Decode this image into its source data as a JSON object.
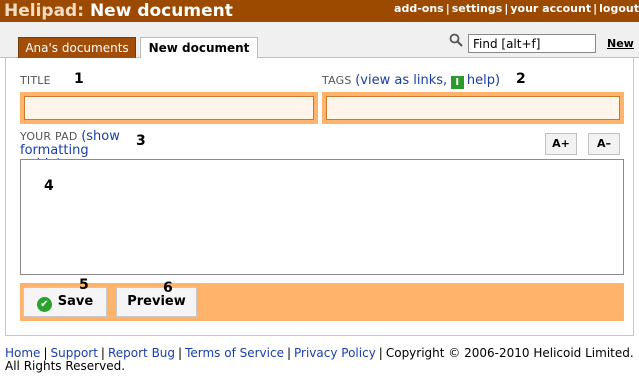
{
  "header": {
    "brand": "Helipad:",
    "page_title": "New document",
    "nav": [
      "add-ons",
      "settings",
      "your account",
      "logout"
    ]
  },
  "tabs": [
    {
      "label": "Ana's documents",
      "active": false
    },
    {
      "label": "New document",
      "active": true
    }
  ],
  "search": {
    "value": "Find [alt+f]",
    "new_label": "New"
  },
  "form": {
    "title_label": "TITLE",
    "title_value": "",
    "tags_label": "TAGS",
    "tags_open": "(",
    "tags_view_link": "view as links",
    "tags_comma": ",",
    "tags_help_link": "help",
    "tags_close": ")",
    "pad_label": "YOUR PAD",
    "pad_guide_open": "(",
    "pad_guide_link": "show formatting guide",
    "pad_guide_close": ")",
    "pad_value": "",
    "font_bigger": "A+",
    "font_smaller": "A–"
  },
  "markers": [
    "1",
    "2",
    "3",
    "4",
    "5",
    "6"
  ],
  "actions": {
    "save_label": "Save",
    "preview_label": "Preview"
  },
  "footer": {
    "links": [
      "Home",
      "Support",
      "Report Bug",
      "Terms of Service",
      "Privacy Policy"
    ],
    "copyright": "Copyright © 2006-2010 Helicoid Limited. All Rights Reserved."
  },
  "colors": {
    "header_bg": "#9c4a00",
    "field_border": "#ffb36b",
    "field_bg": "#fff5ea",
    "link": "#1a3ea8"
  },
  "icons": [
    "search-icon",
    "info-icon",
    "check-icon"
  ]
}
